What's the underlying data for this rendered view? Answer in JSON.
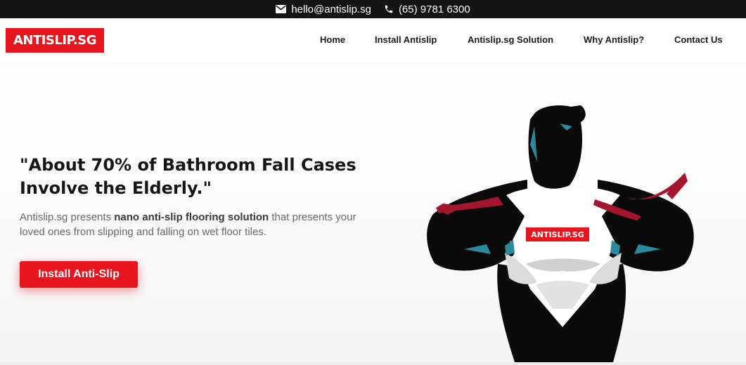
{
  "topbar": {
    "email": "hello@antislip.sg",
    "phone": "(65) 9781 6300",
    "email_icon": "envelope-icon",
    "phone_icon": "phone-icon"
  },
  "header": {
    "logo_text": "ANTISLIP.SG",
    "nav": [
      {
        "label": "Home"
      },
      {
        "label": "Install Antislip"
      },
      {
        "label": "Antislip.sg Solution"
      },
      {
        "label": "Why Antislip?"
      },
      {
        "label": "Contact Us"
      }
    ]
  },
  "hero": {
    "headline": "\"About 70% of Bathroom Fall Cases Involve the Elderly.\"",
    "lead_prefix": "Antislip.sg presents ",
    "lead_bold": "nano anti-slip flooring solution",
    "lead_suffix": " that presents your loved ones from slipping and falling on wet floor tiles.",
    "cta_label": "Install Anti-Slip",
    "illustration_badge": "ANTISLIP.SG"
  },
  "colors": {
    "brand_red": "#e8141e",
    "topbar_bg": "#141414",
    "tie_red": "#a3162e",
    "accent_teal": "#2a8aa0"
  }
}
